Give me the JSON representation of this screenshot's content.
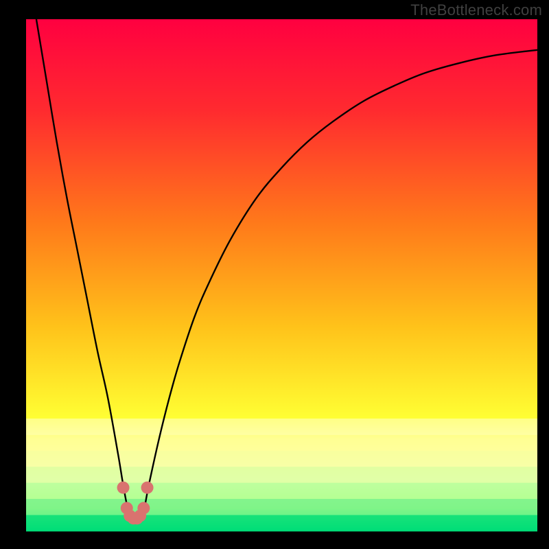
{
  "watermark": "TheBottleneck.com",
  "chart_data": {
    "type": "line",
    "title": "",
    "xlabel": "",
    "ylabel": "",
    "xlim": [
      0,
      100
    ],
    "ylim": [
      0,
      100
    ],
    "grid": false,
    "legend": false,
    "annotations": [],
    "background": {
      "type": "vertical-gradient",
      "stops": [
        {
          "pos": 0.0,
          "color": "#ff0040"
        },
        {
          "pos": 0.18,
          "color": "#ff2b2f"
        },
        {
          "pos": 0.4,
          "color": "#ff7a1a"
        },
        {
          "pos": 0.6,
          "color": "#ffc21a"
        },
        {
          "pos": 0.78,
          "color": "#ffff33"
        },
        {
          "pos": 0.82,
          "color": "#ffff88"
        },
        {
          "pos": 0.9,
          "color": "#ffffb0"
        },
        {
          "pos": 0.955,
          "color": "#d8ff80"
        },
        {
          "pos": 0.975,
          "color": "#80ff80"
        },
        {
          "pos": 1.0,
          "color": "#00e676"
        }
      ]
    },
    "series": [
      {
        "name": "bottleneck-curve",
        "color": "#000000",
        "x": [
          2.0,
          4.0,
          6.0,
          8.0,
          10.0,
          12.0,
          14.0,
          16.0,
          18.0,
          19.0,
          20.0,
          21.0,
          22.0,
          23.0,
          24.0,
          26.0,
          28.0,
          30.0,
          33.0,
          36.0,
          40.0,
          45.0,
          50.0,
          55.0,
          60.0,
          66.0,
          72.0,
          78.0,
          85.0,
          92.0,
          100.0
        ],
        "values": [
          100.0,
          88.0,
          76.0,
          65.0,
          55.0,
          45.0,
          35.0,
          26.0,
          15.0,
          9.0,
          4.0,
          2.5,
          2.5,
          4.0,
          9.0,
          18.0,
          26.0,
          33.0,
          42.0,
          49.0,
          57.0,
          65.0,
          71.0,
          76.0,
          80.0,
          84.0,
          87.0,
          89.5,
          91.5,
          93.0,
          94.0
        ]
      }
    ],
    "markers": {
      "name": "highlight-points",
      "color": "#d9736f",
      "points": [
        {
          "x": 19.0,
          "y": 8.5
        },
        {
          "x": 19.7,
          "y": 4.5
        },
        {
          "x": 20.3,
          "y": 3.0
        },
        {
          "x": 21.0,
          "y": 2.5
        },
        {
          "x": 21.7,
          "y": 2.5
        },
        {
          "x": 22.3,
          "y": 3.0
        },
        {
          "x": 23.0,
          "y": 4.5
        },
        {
          "x": 23.7,
          "y": 8.5
        }
      ]
    }
  }
}
